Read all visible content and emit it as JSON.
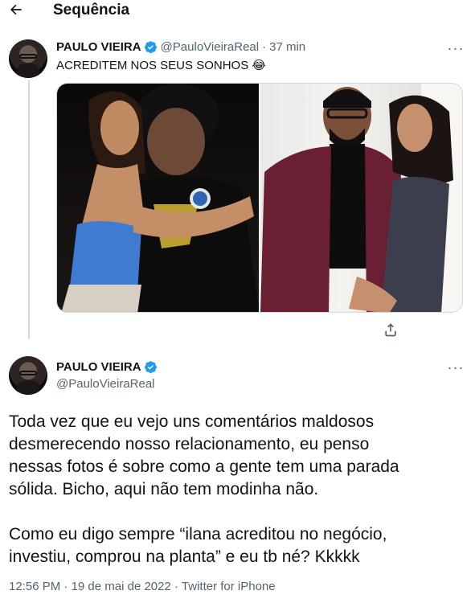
{
  "header": {
    "title": "Sequência",
    "back_icon": "arrow-left-icon"
  },
  "first_tweet": {
    "display_name": "PAULO VIEIRA",
    "handle": "@PauloVieiraReal",
    "separator": "·",
    "time": "37 min",
    "text": "ACREDITEM NOS SEUS SONHOS 😂",
    "more_label": "···"
  },
  "main_tweet": {
    "display_name": "PAULO VIEIRA",
    "handle": "@PauloVieiraReal",
    "more_label": "···",
    "lines": [
      "Toda vez que eu vejo uns comentários maldosos",
      "desmerecendo nosso relacionamento, eu penso",
      "nessas fotos é sobre como a gente tem uma parada",
      "sólida. Bicho, aqui não tem modinha não.",
      "",
      "Como eu digo sempre “ilana acreditou no negócio,",
      "investiu, comprou na planta” e eu tb né? Kkkkk"
    ],
    "meta": {
      "time": "12:56 PM",
      "sep1": "·",
      "date": "19 de mai de 2022",
      "sep2": "·",
      "source": "Twitter for iPhone"
    }
  },
  "colors": {
    "text": "#0f1419",
    "secondary": "#536471",
    "verified": "#1d9bf0",
    "thread_line": "#cfd9de"
  }
}
